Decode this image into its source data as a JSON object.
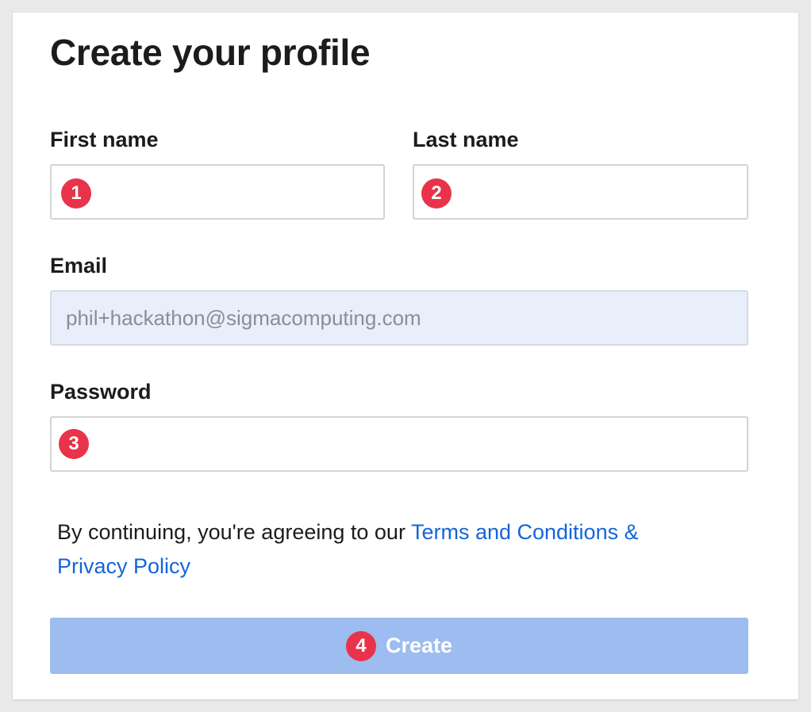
{
  "page": {
    "title": "Create your profile"
  },
  "form": {
    "first_name": {
      "label": "First name",
      "value": "",
      "badge": "1"
    },
    "last_name": {
      "label": "Last name",
      "value": "",
      "badge": "2"
    },
    "email": {
      "label": "Email",
      "value": "phil+hackathon@sigmacomputing.com"
    },
    "password": {
      "label": "Password",
      "value": "",
      "badge": "3"
    }
  },
  "legal": {
    "text": "By continuing, you're agreeing to our ",
    "link_terms": "Terms and Conditions &",
    "link_privacy": "Privacy Policy"
  },
  "actions": {
    "create_label": "Create",
    "create_badge": "4"
  },
  "colors": {
    "page_background": "#e9e9e9",
    "card_background": "#ffffff",
    "link": "#1565d8",
    "button_disabled": "#9dbcef",
    "badge": "#e8334a",
    "readonly_field": "#e8eefa"
  }
}
